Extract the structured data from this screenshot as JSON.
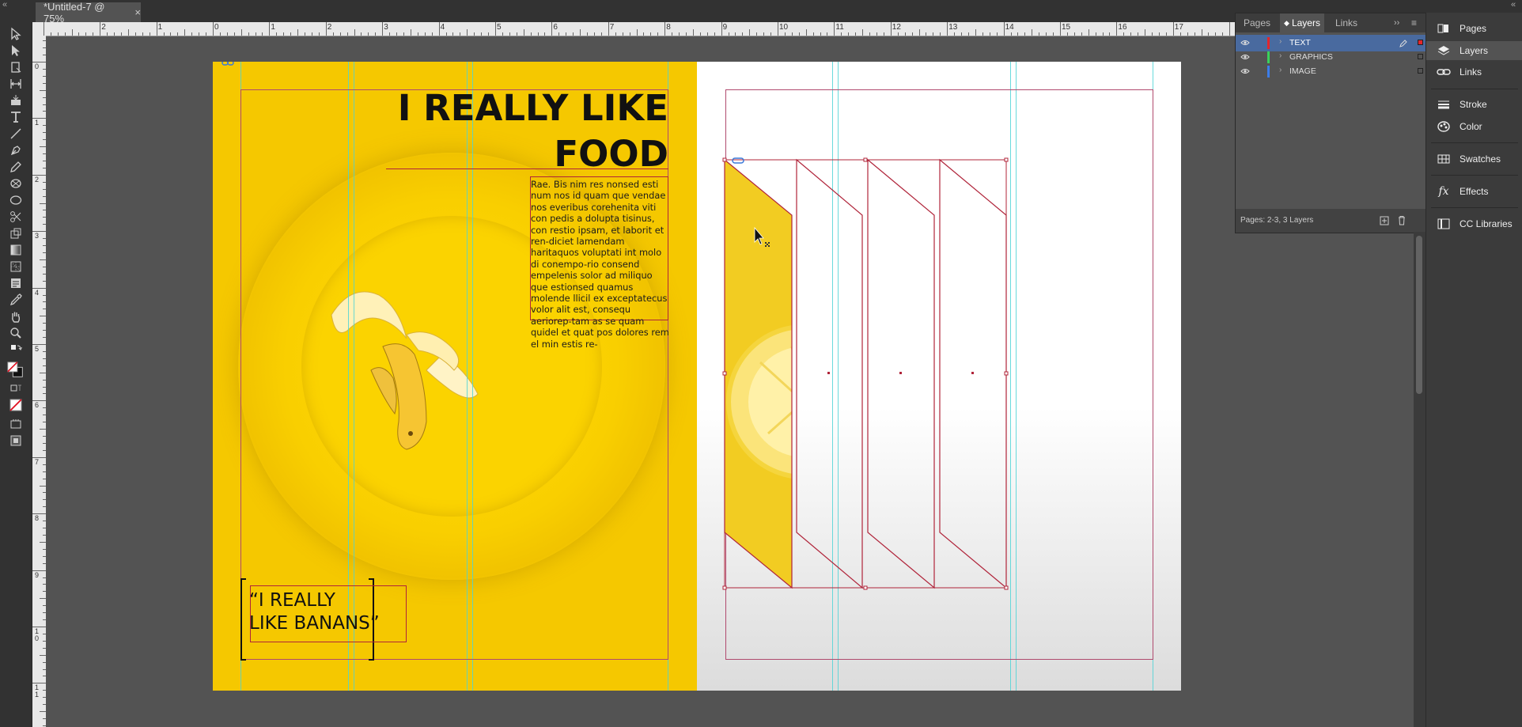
{
  "document_tab": {
    "title": "*Untitled-7 @ 75%",
    "close": "×"
  },
  "ruler": {
    "horizontal_labels": [
      "2",
      "1",
      "0",
      "1",
      "2",
      "3",
      "4",
      "5",
      "6",
      "7",
      "8",
      "9",
      "10",
      "11",
      "12",
      "13",
      "14",
      "15",
      "16",
      "17"
    ],
    "vertical_labels": [
      "0",
      "1",
      "2",
      "3",
      "4",
      "5",
      "6",
      "7",
      "8",
      "9",
      "10",
      "11"
    ]
  },
  "spread": {
    "headline_line1": "I REALLY LIKE",
    "headline_line2": "FOOD",
    "body_text": "Rae. Bis nim res nonsed esti num nos id quam que vendae nos everibus corehenita viti con pedis a dolupta tisinus, con restio ipsam, et laborit et ren-diciet lamendam haritaquos voluptati int molo di conempo-rio consend empelenis solor ad miliquo que estionsed quamus molende llicil ex exceptatecus volor alit est, consequ aeriorep-tam as se quam quidel et quat pos dolores rem el min estis re-",
    "quote_line1": "“I REALLY",
    "quote_line2": "LIKE BANANS”"
  },
  "layers_panel": {
    "tabs": [
      "Pages",
      "Layers",
      "Links"
    ],
    "active_tab": "Layers",
    "layers": [
      {
        "name": "TEXT",
        "color": "#e3262c",
        "selected": true
      },
      {
        "name": "GRAPHICS",
        "color": "#39d15a",
        "selected": false
      },
      {
        "name": "IMAGE",
        "color": "#3c7de8",
        "selected": false
      }
    ],
    "status": "Pages: 2-3, 3 Layers"
  },
  "dock": {
    "items": [
      "Pages",
      "Layers",
      "Links",
      "Stroke",
      "Color",
      "Swatches",
      "Effects",
      "CC Libraries"
    ]
  },
  "colors": {
    "accent": "#496a9f",
    "page_yellow": "#f5c800",
    "frame_red": "#b0243a",
    "guide_cyan": "#4fd3d6"
  }
}
